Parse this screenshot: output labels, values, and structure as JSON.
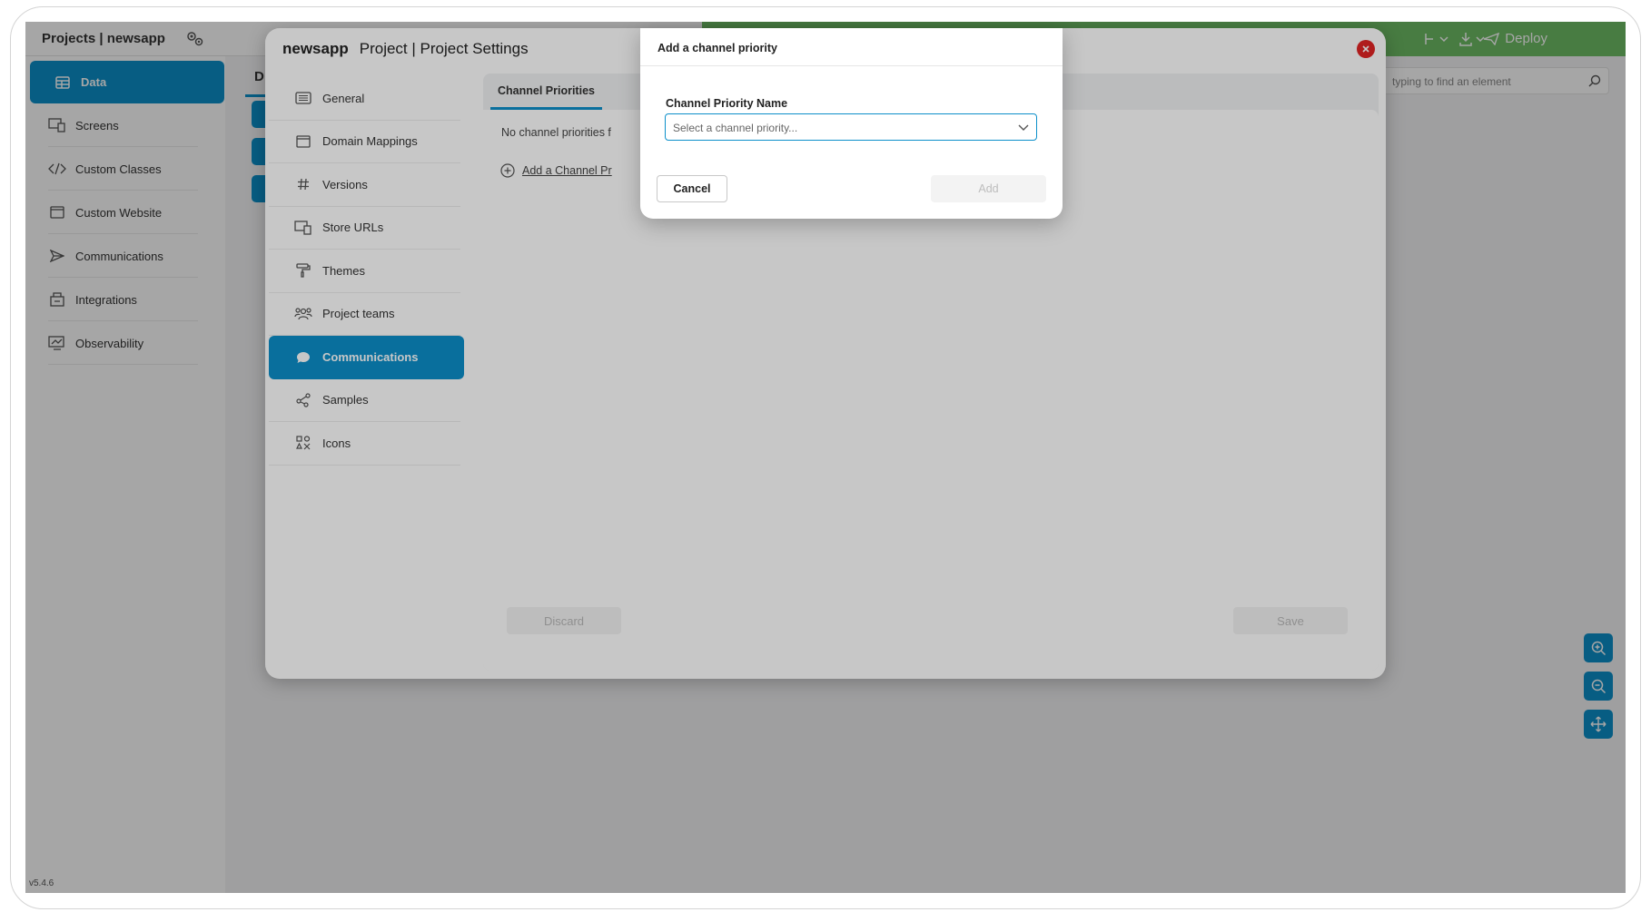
{
  "topbar": {
    "project_title": "Projects | newsapp",
    "deploy_label": "Deploy",
    "search_placeholder": "typing to find an element"
  },
  "sidebar": {
    "items": [
      {
        "label": "Data",
        "icon": "table-icon",
        "active": true
      },
      {
        "label": "Screens",
        "icon": "screens-icon"
      },
      {
        "label": "Custom Classes",
        "icon": "code-icon"
      },
      {
        "label": "Custom Website",
        "icon": "website-icon"
      },
      {
        "label": "Communications",
        "icon": "send-icon"
      },
      {
        "label": "Integrations",
        "icon": "integrations-icon"
      },
      {
        "label": "Observability",
        "icon": "observability-icon"
      }
    ]
  },
  "background_tab": "D",
  "version": "v5.4.6",
  "settings": {
    "app_name": "newsapp",
    "title": "Project | Project Settings",
    "nav": [
      {
        "label": "General",
        "icon": "list-icon"
      },
      {
        "label": "Domain Mappings",
        "icon": "browser-icon"
      },
      {
        "label": "Versions",
        "icon": "hash-icon"
      },
      {
        "label": "Store URLs",
        "icon": "devices-icon"
      },
      {
        "label": "Themes",
        "icon": "paint-roller-icon"
      },
      {
        "label": "Project teams",
        "icon": "team-icon"
      },
      {
        "label": "Communications",
        "icon": "chat-bubble-icon",
        "active": true
      },
      {
        "label": "Samples",
        "icon": "share-icon"
      },
      {
        "label": "Icons",
        "icon": "icons-grid-icon"
      }
    ],
    "tab_label": "Channel Priorities",
    "empty_text": "No channel priorities f",
    "add_link": "Add a Channel Pr",
    "discard_label": "Discard",
    "save_label": "Save"
  },
  "modal": {
    "title": "Add a channel priority",
    "field_label": "Channel Priority Name",
    "select_placeholder": "Select a channel priority...",
    "cancel_label": "Cancel",
    "add_label": "Add"
  },
  "colors": {
    "accent": "#0c8fca",
    "topbar_green": "#6fbf66",
    "close_red": "#e02424"
  }
}
